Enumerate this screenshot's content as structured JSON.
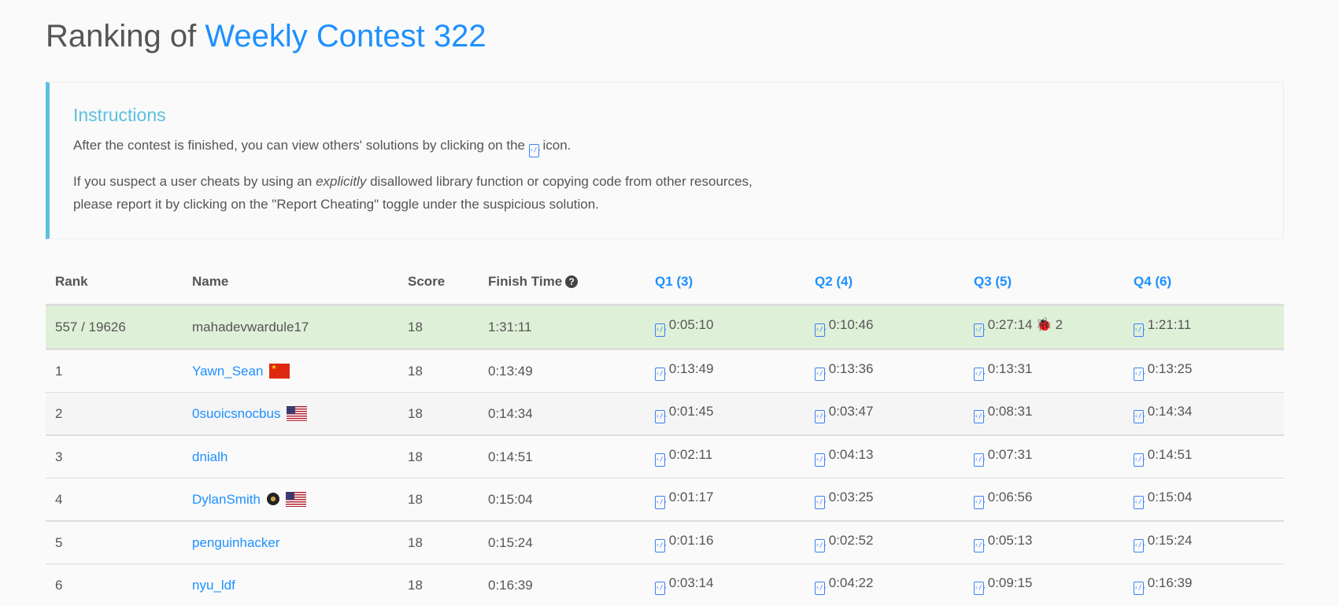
{
  "title": {
    "prefix": "Ranking of",
    "contest": "Weekly Contest 322"
  },
  "instructions": {
    "heading": "Instructions",
    "line1_before": "After the contest is finished, you can view others' solutions by clicking on the",
    "line1_after": "icon.",
    "line2_before": "If you suspect a user cheats by using an",
    "line2_em": "explicitly",
    "line2_after": "disallowed library function or copying code from other resources,",
    "line3": "please report it by clicking on the \"Report Cheating\" toggle under the suspicious solution."
  },
  "columns": [
    "Rank",
    "Name",
    "Score",
    "Finish Time",
    "Q1 (3)",
    "Q2 (4)",
    "Q3 (5)",
    "Q4 (6)"
  ],
  "colors": {
    "accent": "#1e90ff",
    "info": "#5bc0de",
    "highlight": "#dff0d8"
  },
  "me": {
    "rank": "557 / 19626",
    "name": "mahadevwardule17",
    "score": "18",
    "finish": "1:31:11",
    "q": [
      "0:05:10",
      "0:10:46",
      "0:27:14",
      "1:21:11"
    ],
    "q3_bugs": "2"
  },
  "rows": [
    {
      "rank": "1",
      "name": "Yawn_Sean",
      "flag": "cn",
      "score": "18",
      "finish": "0:13:49",
      "q": [
        "0:13:49",
        "0:13:36",
        "0:13:31",
        "0:13:25"
      ]
    },
    {
      "rank": "2",
      "name": "0suoicsnocbus",
      "flag": "us",
      "score": "18",
      "finish": "0:14:34",
      "q": [
        "0:01:45",
        "0:03:47",
        "0:08:31",
        "0:14:34"
      ]
    },
    {
      "rank": "3",
      "name": "dnialh",
      "score": "18",
      "finish": "0:14:51",
      "q": [
        "0:02:11",
        "0:04:13",
        "0:07:31",
        "0:14:51"
      ]
    },
    {
      "rank": "4",
      "name": "DylanSmith",
      "badge": true,
      "flag": "us",
      "score": "18",
      "finish": "0:15:04",
      "q": [
        "0:01:17",
        "0:03:25",
        "0:06:56",
        "0:15:04"
      ]
    },
    {
      "rank": "5",
      "name": "penguinhacker",
      "score": "18",
      "finish": "0:15:24",
      "q": [
        "0:01:16",
        "0:02:52",
        "0:05:13",
        "0:15:24"
      ]
    },
    {
      "rank": "6",
      "name": "nyu_ldf",
      "score": "18",
      "finish": "0:16:39",
      "q": [
        "0:03:14",
        "0:04:22",
        "0:09:15",
        "0:16:39"
      ]
    }
  ]
}
